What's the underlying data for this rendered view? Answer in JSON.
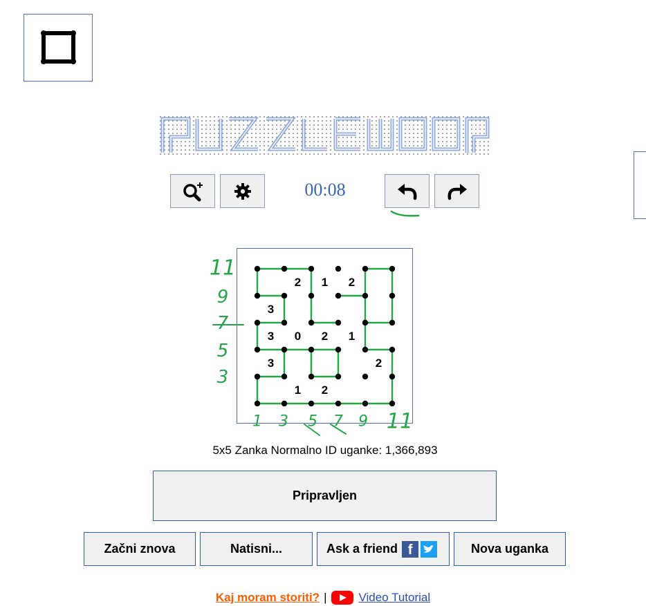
{
  "timer": "00:08",
  "info_line": "5x5 Zanka Normalno ID uganke: 1,366,893",
  "buttons": {
    "ready": "Pripravljen",
    "restart": "Začni znova",
    "print": "Natisni...",
    "ask": "Ask a friend",
    "new": "Nova uganka"
  },
  "footer": {
    "help": "Kaj moram storiti?",
    "separator": "|",
    "video": "Video Tutorial"
  },
  "logo_text": "PUZZLE LOOP",
  "icons": {
    "square": "square-icon",
    "zoom": "zoom-in-icon",
    "settings": "gear-icon",
    "undo": "undo-icon",
    "redo": "redo-icon",
    "facebook": "facebook-icon",
    "twitter": "twitter-icon",
    "youtube": "youtube-icon"
  },
  "puzzle": {
    "size": 5,
    "clues": [
      [
        "",
        "2",
        "1",
        "2",
        ""
      ],
      [
        "3",
        "",
        "",
        "",
        ""
      ],
      [
        "3",
        "0",
        "2",
        "1",
        ""
      ],
      [
        "3",
        "",
        "",
        "",
        "2"
      ],
      [
        "",
        "1",
        "2",
        "",
        ""
      ]
    ]
  },
  "handwritten": {
    "left": [
      "11",
      "9",
      "7",
      "5",
      "3"
    ],
    "bottom": [
      "1",
      "3",
      "5",
      "7",
      "9",
      "11"
    ]
  },
  "colors": {
    "accent": "#3a66b4",
    "loop": "#22a447",
    "help_link": "#ff5a00",
    "video_link": "#2a4bb5",
    "button_border": "#2e5ea8"
  }
}
